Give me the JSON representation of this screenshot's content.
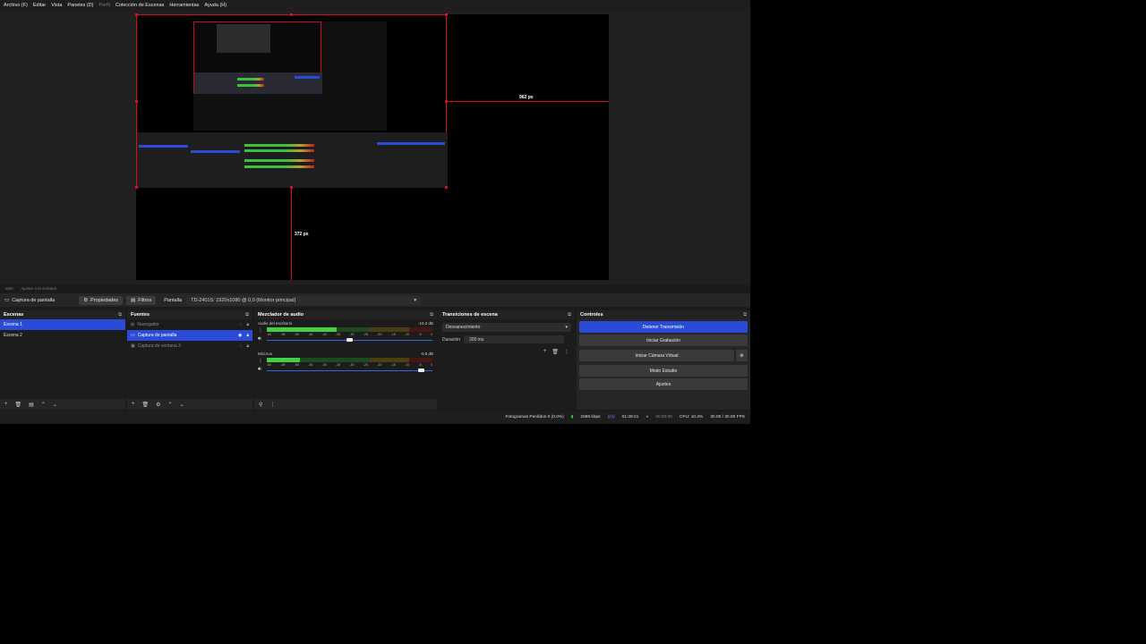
{
  "menu": {
    "items": [
      "Archivo (F)",
      "Editar",
      "Vista",
      "Paneles (D)",
      "Perfil",
      "Colección de Escenas",
      "Herramientas",
      "Ayuda (H)"
    ]
  },
  "preview": {
    "width_label": "962 px",
    "height_label": "372 px",
    "footer_items": [
      "EDK",
      "Ajustar a la ventana"
    ]
  },
  "source_toolbar": {
    "source_name": "Captura de pantalla",
    "properties_label": "Propiedades",
    "filters_label": "Filtros",
    "screen_label": "Pantalla",
    "screen_value": "TD-2401S: 1920x1080 @ 0,0 (Monitor principal)"
  },
  "scenes": {
    "title": "Escenas",
    "items": [
      {
        "label": "Escena 1",
        "selected": true
      },
      {
        "label": "Escena 2",
        "selected": false
      }
    ]
  },
  "sources": {
    "title": "Fuentes",
    "items": [
      {
        "label": "Navegador",
        "selected": false,
        "dim": true
      },
      {
        "label": "Captura de pantalla",
        "selected": true,
        "dim": false
      },
      {
        "label": "Captura de ventana 3",
        "selected": false,
        "dim": true
      }
    ]
  },
  "mixer": {
    "title": "Mezclador de audio",
    "channels": [
      {
        "name": "Audio del escritorio",
        "db": "-10.3 dB",
        "level": 0.42,
        "volume": 0.52
      },
      {
        "name": "Mic/Aux",
        "db": "-0.8 dB",
        "level": 0.2,
        "volume": 0.95
      }
    ],
    "ticks": [
      "-60",
      "-55",
      "-50",
      "-45",
      "-40",
      "-35",
      "-30",
      "-25",
      "-20",
      "-15",
      "-10",
      "-5",
      "0"
    ]
  },
  "transitions": {
    "title": "Transiciones de escena",
    "selected": "Desvanecimiento",
    "duration_label": "Duración",
    "duration_value": "300 ms"
  },
  "controls": {
    "title": "Controles",
    "buttons": [
      "Detener Transmisión",
      "Iniciar Grabación",
      "Iniciar Cámara Virtual",
      "Modo Estudio",
      "Ajustes"
    ]
  },
  "status": {
    "dropped_frames": "Fotogramas Perdidos 0 (0.0%)",
    "bitrate": "2688 kbps",
    "stream_time": "01:39:21",
    "rec_time": "00:00:00",
    "cpu": "CPU: 10.3%",
    "fps": "30.00 / 30.00 FPS"
  },
  "colors": {
    "accent": "#2a4bd8",
    "guide": "#d01020",
    "meter_green": "#44d044"
  }
}
